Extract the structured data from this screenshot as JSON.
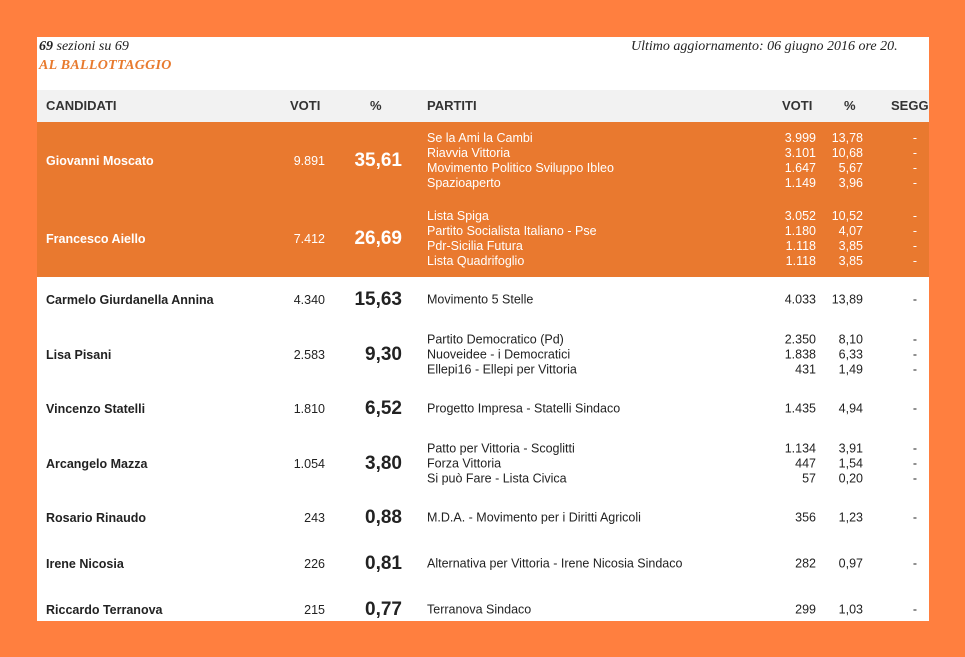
{
  "header": {
    "sections_count": "69",
    "sections_text": "sezioni su 69",
    "status": "AL BALLOTTAGGIO",
    "updated": "Ultimo aggiornamento: 06 giugno 2016 ore 20."
  },
  "columns": {
    "candidates": "CANDIDATI",
    "votes": "VOTI",
    "pct": "%",
    "parties": "PARTITI",
    "party_votes": "VOTI",
    "party_pct": "%",
    "seats": "SEGG"
  },
  "candidates": [
    {
      "name": "Giovanni Moscato",
      "votes": "9.891",
      "pct": "35,61",
      "highlight": true,
      "parties": [
        {
          "name": "Se la Ami la Cambi",
          "votes": "3.999",
          "pct": "13,78",
          "seats": "-"
        },
        {
          "name": "Riavvia Vittoria",
          "votes": "3.101",
          "pct": "10,68",
          "seats": "-"
        },
        {
          "name": "Movimento Politico Sviluppo Ibleo",
          "votes": "1.647",
          "pct": "5,67",
          "seats": "-"
        },
        {
          "name": "Spazioaperto",
          "votes": "1.149",
          "pct": "3,96",
          "seats": "-"
        }
      ]
    },
    {
      "name": "Francesco Aiello",
      "votes": "7.412",
      "pct": "26,69",
      "highlight": true,
      "parties": [
        {
          "name": "Lista Spiga",
          "votes": "3.052",
          "pct": "10,52",
          "seats": "-"
        },
        {
          "name": "Partito Socialista Italiano - Pse",
          "votes": "1.180",
          "pct": "4,07",
          "seats": "-"
        },
        {
          "name": "Pdr-Sicilia Futura",
          "votes": "1.118",
          "pct": "3,85",
          "seats": "-"
        },
        {
          "name": "Lista Quadrifoglio",
          "votes": "1.118",
          "pct": "3,85",
          "seats": "-"
        }
      ]
    },
    {
      "name": "Carmelo Giurdanella Annina",
      "votes": "4.340",
      "pct": "15,63",
      "highlight": false,
      "parties": [
        {
          "name": "Movimento 5 Stelle",
          "votes": "4.033",
          "pct": "13,89",
          "seats": "-"
        }
      ]
    },
    {
      "name": "Lisa Pisani",
      "votes": "2.583",
      "pct": "9,30",
      "highlight": false,
      "parties": [
        {
          "name": "Partito Democratico (Pd)",
          "votes": "2.350",
          "pct": "8,10",
          "seats": "-"
        },
        {
          "name": "Nuoveidee - i Democratici",
          "votes": "1.838",
          "pct": "6,33",
          "seats": "-"
        },
        {
          "name": "Ellepi16 - Ellepi per Vittoria",
          "votes": "431",
          "pct": "1,49",
          "seats": "-"
        }
      ]
    },
    {
      "name": "Vincenzo Statelli",
      "votes": "1.810",
      "pct": "6,52",
      "highlight": false,
      "parties": [
        {
          "name": "Progetto Impresa - Statelli Sindaco",
          "votes": "1.435",
          "pct": "4,94",
          "seats": "-"
        }
      ]
    },
    {
      "name": "Arcangelo Mazza",
      "votes": "1.054",
      "pct": "3,80",
      "highlight": false,
      "parties": [
        {
          "name": "Patto per Vittoria - Scoglitti",
          "votes": "1.134",
          "pct": "3,91",
          "seats": "-"
        },
        {
          "name": "Forza Vittoria",
          "votes": "447",
          "pct": "1,54",
          "seats": "-"
        },
        {
          "name": "Si può Fare - Lista Civica",
          "votes": "57",
          "pct": "0,20",
          "seats": "-"
        }
      ]
    },
    {
      "name": "Rosario Rinaudo",
      "votes": "243",
      "pct": "0,88",
      "highlight": false,
      "parties": [
        {
          "name": "M.D.A. - Movimento per i Diritti Agricoli",
          "votes": "356",
          "pct": "1,23",
          "seats": "-"
        }
      ]
    },
    {
      "name": "Irene Nicosia",
      "votes": "226",
      "pct": "0,81",
      "highlight": false,
      "parties": [
        {
          "name": "Alternativa per Vittoria - Irene Nicosia Sindaco",
          "votes": "282",
          "pct": "0,97",
          "seats": "-"
        }
      ]
    },
    {
      "name": "Riccardo Terranova",
      "votes": "215",
      "pct": "0,77",
      "highlight": false,
      "parties": [
        {
          "name": "Terranova Sindaco",
          "votes": "299",
          "pct": "1,03",
          "seats": "-"
        }
      ]
    }
  ],
  "colors": {
    "frame": "#ff7f3f",
    "highlight_row": "#e9792f",
    "status_text": "#e87a2e",
    "header_bg": "#f2f2f2"
  }
}
